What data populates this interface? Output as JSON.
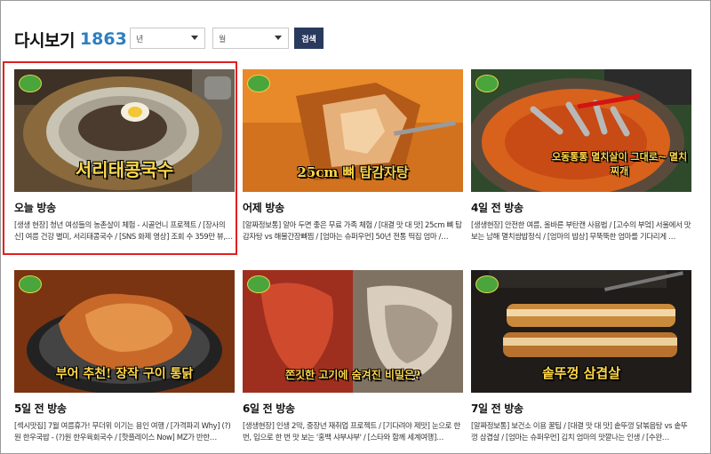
{
  "page": {
    "title": "다시보기",
    "count": "1863"
  },
  "filters": {
    "year": {
      "value": "년"
    },
    "month": {
      "value": "월"
    },
    "search_label": "검색"
  },
  "episodes": [
    {
      "title": "오늘 방송",
      "caption": "서리태콩국수",
      "desc": "[생생 현장] 청년 여성들의 농촌살이 체험 - 시골언니 프로젝트 / [장사의 신] 여름 건강 별미, 서리태콩국수 / [SNS 화제 영상] 조회 수 359만 뷰,…"
    },
    {
      "title": "어제 방송",
      "caption": "25cm 뼈 탑감자탕",
      "desc": "[알짜정보통] 알아 두면 좋은 무료 가족 체험 / [대결 맛 대 맛] 25cm 뼈 탑감자탕 vs 해물간장뼈찜 / [엄마는 슈퍼우먼] 50년 전통 떡집 엄마 /…"
    },
    {
      "title": "4일 전 방송",
      "caption": "오동통통 멸치살이 그대로~ 멸치찌개",
      "desc": "[생생현장] 안전한 여름, 올바른 부탄캔 사용법 / [고수의 부엌] 서울에서 맛보는 남해 멸치쌈밥정식 / [엄마의 밥상] 무뚝뚝한 엄마를 기다리게 …"
    },
    {
      "title": "5일 전 방송",
      "caption": "부어 추천! 장작 구이 통닭",
      "desc": "[섹시맛집] 7월 여름휴가! 무더위 이기는 용인 여행 / [가격파괴 Why] (?)원 한우국밥 - (?)원 한우육회국수 / [핫플레이스 Now] MZ가 반한…"
    },
    {
      "title": "6일 전 방송",
      "caption": "쫀깃한 고기에 숨겨진 비밀은?",
      "desc": "[생생현장] 인생 2막, 중장년 재취업 프로젝트 / [기다려야 제맛] 눈으로 한 번, 입으로 한 번 맛 보는 '홍백 샤부샤부' / [스타와 함께 세계여행]…"
    },
    {
      "title": "7일 전 방송",
      "caption": "솥뚜껑 삼겹살",
      "desc": "[알짜정보통] 보건소 이용 꿀팁 / [대결 맛 대 맛] 솥뚜껑 닭볶음탕 vs 솥뚜껑 삼겹살 / [엄마는 슈퍼우먼] 김치 엄마의 맛깔나는 인생 / [수완…"
    }
  ]
}
